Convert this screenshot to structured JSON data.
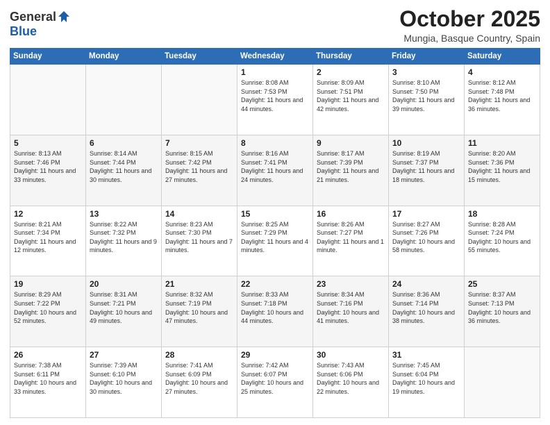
{
  "header": {
    "logo_line1": "General",
    "logo_line2": "Blue",
    "month": "October 2025",
    "location": "Mungia, Basque Country, Spain"
  },
  "weekdays": [
    "Sunday",
    "Monday",
    "Tuesday",
    "Wednesday",
    "Thursday",
    "Friday",
    "Saturday"
  ],
  "weeks": [
    [
      {
        "day": "",
        "sunrise": "",
        "sunset": "",
        "daylight": ""
      },
      {
        "day": "",
        "sunrise": "",
        "sunset": "",
        "daylight": ""
      },
      {
        "day": "",
        "sunrise": "",
        "sunset": "",
        "daylight": ""
      },
      {
        "day": "1",
        "sunrise": "Sunrise: 8:08 AM",
        "sunset": "Sunset: 7:53 PM",
        "daylight": "Daylight: 11 hours and 44 minutes."
      },
      {
        "day": "2",
        "sunrise": "Sunrise: 8:09 AM",
        "sunset": "Sunset: 7:51 PM",
        "daylight": "Daylight: 11 hours and 42 minutes."
      },
      {
        "day": "3",
        "sunrise": "Sunrise: 8:10 AM",
        "sunset": "Sunset: 7:50 PM",
        "daylight": "Daylight: 11 hours and 39 minutes."
      },
      {
        "day": "4",
        "sunrise": "Sunrise: 8:12 AM",
        "sunset": "Sunset: 7:48 PM",
        "daylight": "Daylight: 11 hours and 36 minutes."
      }
    ],
    [
      {
        "day": "5",
        "sunrise": "Sunrise: 8:13 AM",
        "sunset": "Sunset: 7:46 PM",
        "daylight": "Daylight: 11 hours and 33 minutes."
      },
      {
        "day": "6",
        "sunrise": "Sunrise: 8:14 AM",
        "sunset": "Sunset: 7:44 PM",
        "daylight": "Daylight: 11 hours and 30 minutes."
      },
      {
        "day": "7",
        "sunrise": "Sunrise: 8:15 AM",
        "sunset": "Sunset: 7:42 PM",
        "daylight": "Daylight: 11 hours and 27 minutes."
      },
      {
        "day": "8",
        "sunrise": "Sunrise: 8:16 AM",
        "sunset": "Sunset: 7:41 PM",
        "daylight": "Daylight: 11 hours and 24 minutes."
      },
      {
        "day": "9",
        "sunrise": "Sunrise: 8:17 AM",
        "sunset": "Sunset: 7:39 PM",
        "daylight": "Daylight: 11 hours and 21 minutes."
      },
      {
        "day": "10",
        "sunrise": "Sunrise: 8:19 AM",
        "sunset": "Sunset: 7:37 PM",
        "daylight": "Daylight: 11 hours and 18 minutes."
      },
      {
        "day": "11",
        "sunrise": "Sunrise: 8:20 AM",
        "sunset": "Sunset: 7:36 PM",
        "daylight": "Daylight: 11 hours and 15 minutes."
      }
    ],
    [
      {
        "day": "12",
        "sunrise": "Sunrise: 8:21 AM",
        "sunset": "Sunset: 7:34 PM",
        "daylight": "Daylight: 11 hours and 12 minutes."
      },
      {
        "day": "13",
        "sunrise": "Sunrise: 8:22 AM",
        "sunset": "Sunset: 7:32 PM",
        "daylight": "Daylight: 11 hours and 9 minutes."
      },
      {
        "day": "14",
        "sunrise": "Sunrise: 8:23 AM",
        "sunset": "Sunset: 7:30 PM",
        "daylight": "Daylight: 11 hours and 7 minutes."
      },
      {
        "day": "15",
        "sunrise": "Sunrise: 8:25 AM",
        "sunset": "Sunset: 7:29 PM",
        "daylight": "Daylight: 11 hours and 4 minutes."
      },
      {
        "day": "16",
        "sunrise": "Sunrise: 8:26 AM",
        "sunset": "Sunset: 7:27 PM",
        "daylight": "Daylight: 11 hours and 1 minute."
      },
      {
        "day": "17",
        "sunrise": "Sunrise: 8:27 AM",
        "sunset": "Sunset: 7:26 PM",
        "daylight": "Daylight: 10 hours and 58 minutes."
      },
      {
        "day": "18",
        "sunrise": "Sunrise: 8:28 AM",
        "sunset": "Sunset: 7:24 PM",
        "daylight": "Daylight: 10 hours and 55 minutes."
      }
    ],
    [
      {
        "day": "19",
        "sunrise": "Sunrise: 8:29 AM",
        "sunset": "Sunset: 7:22 PM",
        "daylight": "Daylight: 10 hours and 52 minutes."
      },
      {
        "day": "20",
        "sunrise": "Sunrise: 8:31 AM",
        "sunset": "Sunset: 7:21 PM",
        "daylight": "Daylight: 10 hours and 49 minutes."
      },
      {
        "day": "21",
        "sunrise": "Sunrise: 8:32 AM",
        "sunset": "Sunset: 7:19 PM",
        "daylight": "Daylight: 10 hours and 47 minutes."
      },
      {
        "day": "22",
        "sunrise": "Sunrise: 8:33 AM",
        "sunset": "Sunset: 7:18 PM",
        "daylight": "Daylight: 10 hours and 44 minutes."
      },
      {
        "day": "23",
        "sunrise": "Sunrise: 8:34 AM",
        "sunset": "Sunset: 7:16 PM",
        "daylight": "Daylight: 10 hours and 41 minutes."
      },
      {
        "day": "24",
        "sunrise": "Sunrise: 8:36 AM",
        "sunset": "Sunset: 7:14 PM",
        "daylight": "Daylight: 10 hours and 38 minutes."
      },
      {
        "day": "25",
        "sunrise": "Sunrise: 8:37 AM",
        "sunset": "Sunset: 7:13 PM",
        "daylight": "Daylight: 10 hours and 36 minutes."
      }
    ],
    [
      {
        "day": "26",
        "sunrise": "Sunrise: 7:38 AM",
        "sunset": "Sunset: 6:11 PM",
        "daylight": "Daylight: 10 hours and 33 minutes."
      },
      {
        "day": "27",
        "sunrise": "Sunrise: 7:39 AM",
        "sunset": "Sunset: 6:10 PM",
        "daylight": "Daylight: 10 hours and 30 minutes."
      },
      {
        "day": "28",
        "sunrise": "Sunrise: 7:41 AM",
        "sunset": "Sunset: 6:09 PM",
        "daylight": "Daylight: 10 hours and 27 minutes."
      },
      {
        "day": "29",
        "sunrise": "Sunrise: 7:42 AM",
        "sunset": "Sunset: 6:07 PM",
        "daylight": "Daylight: 10 hours and 25 minutes."
      },
      {
        "day": "30",
        "sunrise": "Sunrise: 7:43 AM",
        "sunset": "Sunset: 6:06 PM",
        "daylight": "Daylight: 10 hours and 22 minutes."
      },
      {
        "day": "31",
        "sunrise": "Sunrise: 7:45 AM",
        "sunset": "Sunset: 6:04 PM",
        "daylight": "Daylight: 10 hours and 19 minutes."
      },
      {
        "day": "",
        "sunrise": "",
        "sunset": "",
        "daylight": ""
      }
    ]
  ]
}
